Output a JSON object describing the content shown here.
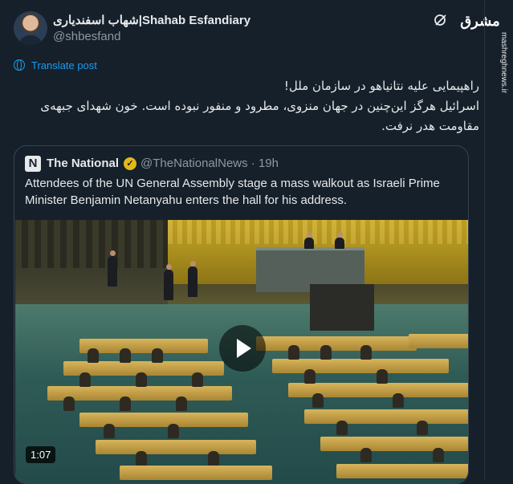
{
  "author": {
    "display_name": "شهاب اسفندیاری|Shahab Esfandiary",
    "handle": "@shbesfand"
  },
  "icons": {
    "grok": "grok-icon",
    "watermark": "mashregh-logo"
  },
  "watermark": {
    "logo_text": "مشرق",
    "site": "mashreghnews.ir"
  },
  "translate_label": "Translate post",
  "post_text": "راهپیمایی علیه نتانیاهو در سازمان ملل!\nاسرائیل هرگز این‌چنین در جهان منزوی، مطرود و منفور نبوده است. خون شهدای جبهه‌ی مقاومت هدر نرفت.",
  "quoted": {
    "logo_letter": "N",
    "name": "The National",
    "handle": "@TheNationalNews",
    "separator": "·",
    "time": "19h",
    "text": "Attendees of the UN General Assembly stage a mass walkout as Israeli Prime Minister Benjamin Netanyahu enters the hall for his address.",
    "video": {
      "duration": "1:07"
    }
  }
}
